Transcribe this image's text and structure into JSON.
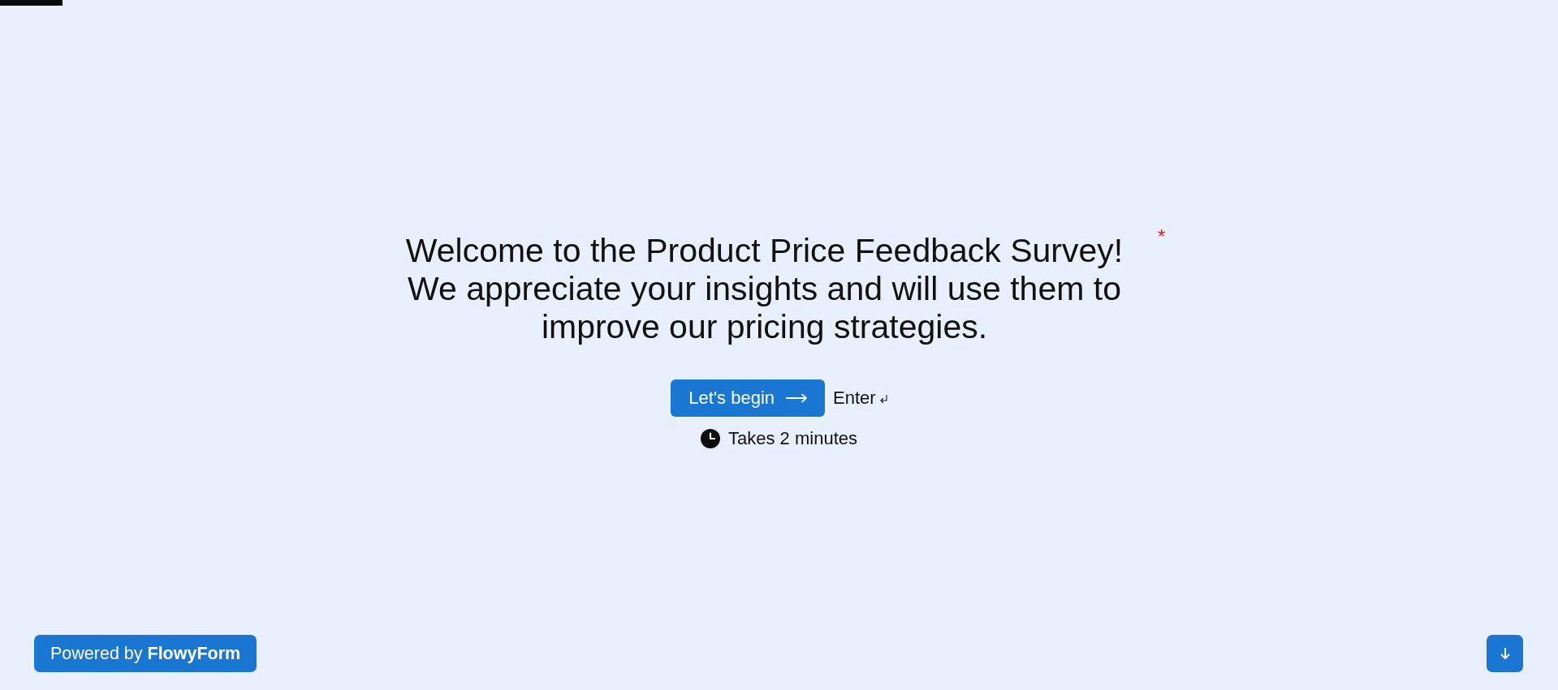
{
  "progress": {
    "level": 0.04
  },
  "question": {
    "title": "Welcome to the Product Price Feedback Survey! We appreciate your insights and will use them to improve our pricing strategies.",
    "required_mark": "*"
  },
  "start_button": {
    "label": "Let's begin"
  },
  "key_hint": {
    "label": "Enter"
  },
  "duration": {
    "text": "Takes 2 minutes"
  },
  "branding": {
    "text": "Powered by **FlowyForm**"
  }
}
